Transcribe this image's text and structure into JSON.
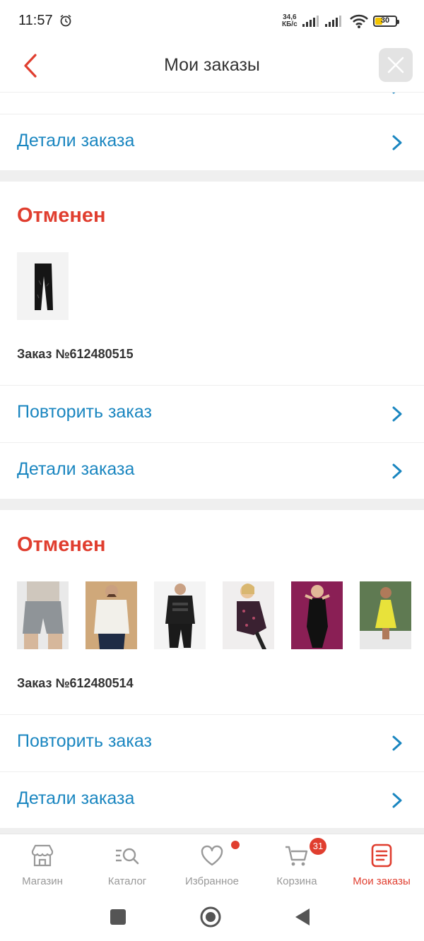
{
  "status_bar": {
    "time": "11:57",
    "speed_value": "34,6",
    "speed_unit": "КБ/с",
    "battery": "30"
  },
  "header": {
    "title": "Мои заказы"
  },
  "partial_order": {
    "details_label": "Детали заказа"
  },
  "orders": [
    {
      "status": "Отменен",
      "order_number": "Заказ №612480515",
      "repeat_label": "Повторить заказ",
      "details_label": "Детали заказа"
    },
    {
      "status": "Отменен",
      "order_number": "Заказ №612480514",
      "repeat_label": "Повторить заказ",
      "details_label": "Детали заказа"
    }
  ],
  "bottom_nav": {
    "items": [
      {
        "label": "Магазин",
        "icon": "store-icon"
      },
      {
        "label": "Каталог",
        "icon": "catalog-search-icon"
      },
      {
        "label": "Избранное",
        "icon": "heart-icon"
      },
      {
        "label": "Корзина",
        "icon": "cart-icon"
      },
      {
        "label": "Мои заказы",
        "icon": "orders-icon"
      }
    ],
    "cart_badge": "31",
    "active_index": 4
  },
  "colors": {
    "accent": "#e03e2f",
    "link": "#1a86c0",
    "separator": "#efefef"
  }
}
